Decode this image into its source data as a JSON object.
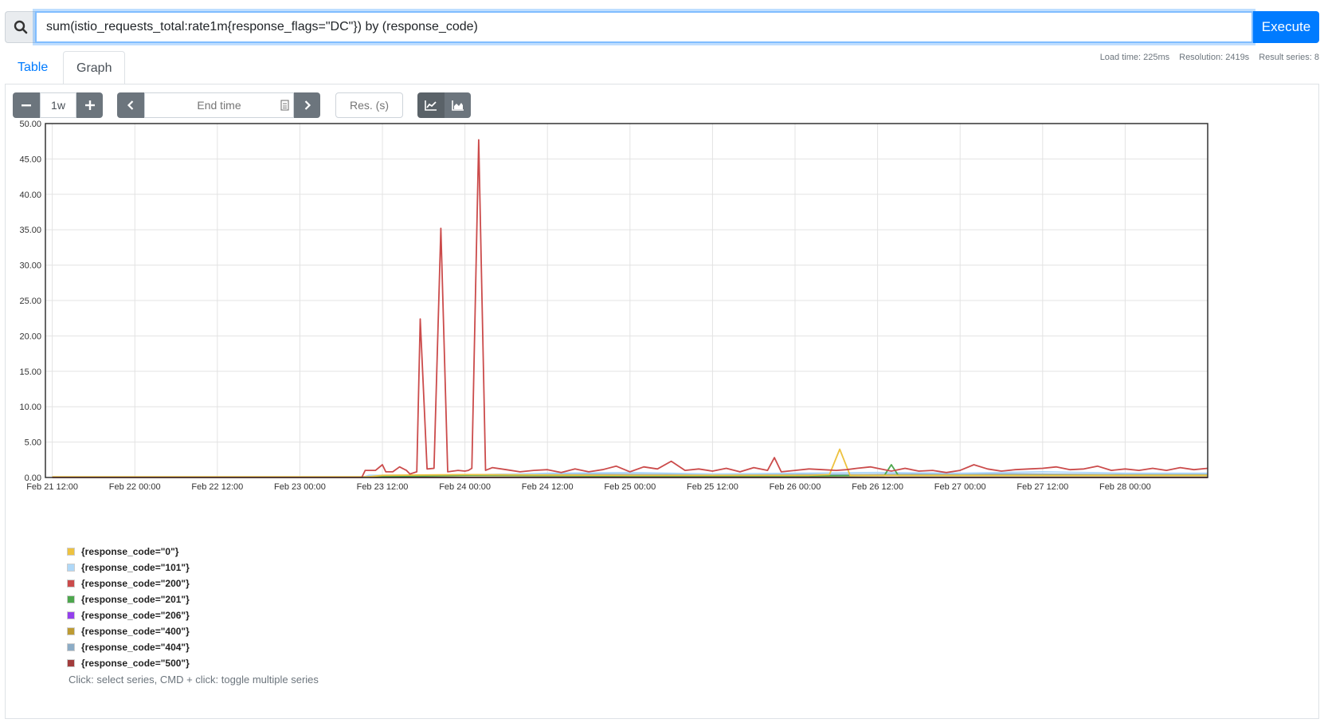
{
  "query": {
    "value": "sum(istio_requests_total:rate1m{response_flags=\"DC\"}) by (response_code)",
    "execute_label": "Execute"
  },
  "tabs": [
    {
      "label": "Table"
    },
    {
      "label": "Graph"
    }
  ],
  "stats": {
    "load_time": "Load time: 225ms",
    "resolution": "Resolution: 2419s",
    "result_series": "Result series: 8"
  },
  "controls": {
    "range_value": "1w",
    "end_time_placeholder": "End time",
    "resolution_placeholder": "Res. (s)"
  },
  "chart_data": {
    "type": "line",
    "ylim": [
      0,
      50
    ],
    "y_ticks": [
      "0.00",
      "5.00",
      "10.00",
      "15.00",
      "20.00",
      "25.00",
      "30.00",
      "35.00",
      "40.00",
      "45.00",
      "50.00"
    ],
    "x_ticks": [
      "Feb 21 12:00",
      "Feb 22 00:00",
      "Feb 22 12:00",
      "Feb 23 00:00",
      "Feb 23 12:00",
      "Feb 24 00:00",
      "Feb 24 12:00",
      "Feb 25 00:00",
      "Feb 25 12:00",
      "Feb 26 00:00",
      "Feb 26 12:00",
      "Feb 27 00:00",
      "Feb 27 12:00",
      "Feb 28 00:00"
    ],
    "x_range_hours": [
      -1,
      168
    ],
    "grid": true,
    "series": [
      {
        "name": "{response_code=\"0\"}",
        "color": "#edc240",
        "points": [
          [
            0,
            0.1
          ],
          [
            12,
            0.1
          ],
          [
            36,
            0.1
          ],
          [
            46,
            0.1
          ],
          [
            48,
            0.3
          ],
          [
            60,
            0.4
          ],
          [
            84,
            0.3
          ],
          [
            110,
            0.3
          ],
          [
            113,
            0.4
          ],
          [
            114.5,
            4.0
          ],
          [
            116,
            0.3
          ],
          [
            130,
            0.3
          ],
          [
            168,
            0.3
          ]
        ]
      },
      {
        "name": "{response_code=\"101\"}",
        "color": "#afd8f8",
        "points": [
          [
            0,
            0
          ],
          [
            45,
            0
          ],
          [
            46,
            0.3
          ],
          [
            60,
            0.3
          ],
          [
            72,
            0.6
          ],
          [
            84,
            0.7
          ],
          [
            96,
            0.5
          ],
          [
            108,
            0.6
          ],
          [
            120,
            0.7
          ],
          [
            132,
            0.6
          ],
          [
            144,
            0.8
          ],
          [
            156,
            0.6
          ],
          [
            168,
            0.6
          ]
        ]
      },
      {
        "name": "{response_code=\"200\"}",
        "color": "#cb4b4b",
        "points": [
          [
            0,
            0
          ],
          [
            45,
            0
          ],
          [
            45.5,
            1.0
          ],
          [
            47,
            1.0
          ],
          [
            48,
            1.8
          ],
          [
            48.5,
            0.8
          ],
          [
            49.5,
            0.8
          ],
          [
            50.5,
            1.5
          ],
          [
            51.5,
            1.0
          ],
          [
            52,
            0.5
          ],
          [
            53,
            0.8
          ],
          [
            53.5,
            22.4
          ],
          [
            54.5,
            1.2
          ],
          [
            55.5,
            1.3
          ],
          [
            56.5,
            35.2
          ],
          [
            57.5,
            0.8
          ],
          [
            59,
            1.0
          ],
          [
            60,
            0.9
          ],
          [
            60.5,
            1.0
          ],
          [
            61,
            1.3
          ],
          [
            62,
            47.7
          ],
          [
            63,
            1.0
          ],
          [
            64,
            1.4
          ],
          [
            66,
            1.1
          ],
          [
            68,
            0.8
          ],
          [
            70,
            1.0
          ],
          [
            72,
            1.1
          ],
          [
            74,
            0.7
          ],
          [
            76,
            1.2
          ],
          [
            78,
            0.8
          ],
          [
            80,
            1.1
          ],
          [
            82,
            1.6
          ],
          [
            84,
            0.8
          ],
          [
            86,
            1.5
          ],
          [
            88,
            1.2
          ],
          [
            90,
            2.3
          ],
          [
            92,
            1.0
          ],
          [
            94,
            1.2
          ],
          [
            96,
            0.9
          ],
          [
            98,
            1.3
          ],
          [
            100,
            0.8
          ],
          [
            102,
            1.4
          ],
          [
            104,
            1.0
          ],
          [
            105,
            2.8
          ],
          [
            106,
            0.8
          ],
          [
            108,
            1.0
          ],
          [
            110,
            1.2
          ],
          [
            112,
            1.1
          ],
          [
            114,
            1.0
          ],
          [
            115.5,
            1.1
          ],
          [
            117,
            1.3
          ],
          [
            119,
            1.5
          ],
          [
            120,
            1.3
          ],
          [
            122,
            0.9
          ],
          [
            124,
            1.3
          ],
          [
            126,
            0.9
          ],
          [
            128,
            1.0
          ],
          [
            130,
            0.7
          ],
          [
            132,
            1.0
          ],
          [
            134,
            1.8
          ],
          [
            136,
            1.2
          ],
          [
            138,
            0.9
          ],
          [
            140,
            1.1
          ],
          [
            142,
            1.2
          ],
          [
            144,
            1.3
          ],
          [
            146,
            1.5
          ],
          [
            148,
            1.1
          ],
          [
            150,
            1.2
          ],
          [
            152,
            1.6
          ],
          [
            154,
            1.0
          ],
          [
            156,
            1.2
          ],
          [
            158,
            1.0
          ],
          [
            160,
            1.3
          ],
          [
            162,
            1.0
          ],
          [
            164,
            1.4
          ],
          [
            166,
            1.1
          ],
          [
            168,
            1.3
          ]
        ]
      },
      {
        "name": "{response_code=\"201\"}",
        "color": "#4da74d",
        "points": [
          [
            0,
            0
          ],
          [
            45,
            0
          ],
          [
            46,
            0.1
          ],
          [
            60,
            0.3
          ],
          [
            84,
            0.2
          ],
          [
            108,
            0.2
          ],
          [
            121,
            0.3
          ],
          [
            122,
            1.8
          ],
          [
            123,
            0.3
          ],
          [
            140,
            0.3
          ],
          [
            168,
            0.3
          ]
        ]
      },
      {
        "name": "{response_code=\"206\"}",
        "color": "#9440ed",
        "points": [
          [
            0,
            0
          ],
          [
            168,
            0
          ]
        ]
      },
      {
        "name": "{response_code=\"400\"}",
        "color": "#bd9b33",
        "points": [
          [
            0,
            0.05
          ],
          [
            168,
            0.05
          ]
        ]
      },
      {
        "name": "{response_code=\"404\"}",
        "color": "#8cacc6",
        "points": [
          [
            0,
            0
          ],
          [
            46,
            0
          ],
          [
            47,
            0.2
          ],
          [
            70,
            0.5
          ],
          [
            92,
            0.4
          ],
          [
            104,
            0.4
          ],
          [
            118,
            0.4
          ],
          [
            130,
            0.5
          ],
          [
            142,
            0.5
          ],
          [
            154,
            0.4
          ],
          [
            168,
            0.5
          ]
        ]
      },
      {
        "name": "{response_code=\"500\"}",
        "color": "#a23c3c",
        "points": [
          [
            0,
            0
          ],
          [
            168,
            0
          ]
        ]
      }
    ]
  },
  "legend_hint": "Click: select series, CMD + click: toggle multiple series"
}
